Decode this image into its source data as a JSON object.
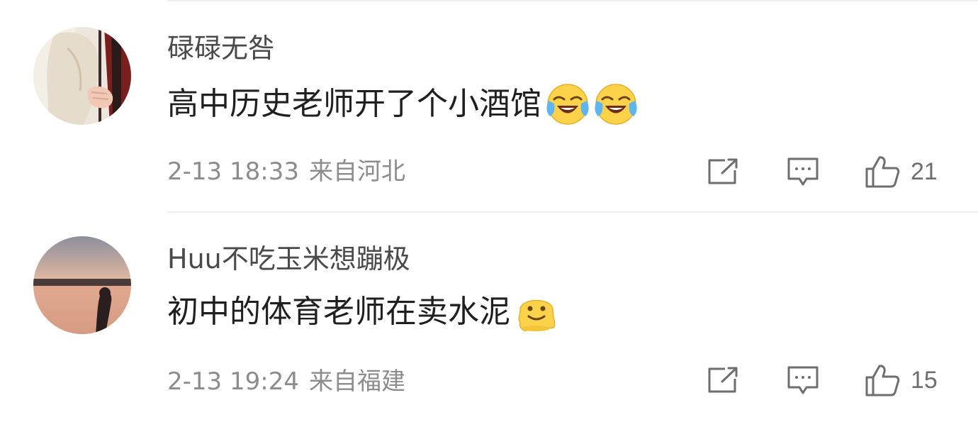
{
  "comments": [
    {
      "username": "碌碌无咎",
      "text": "高中历史老师开了个小酒馆",
      "emojis": [
        "laugh-cry-emoji",
        "laugh-cry-emoji"
      ],
      "date": "2-13 18:33",
      "location": "来自河北",
      "likes": "21"
    },
    {
      "username": "Huu不吃玉米想蹦极",
      "text": "初中的体育老师在卖水泥",
      "emojis": [
        "melting-face-emoji"
      ],
      "date": "2-13 19:24",
      "location": "来自福建",
      "likes": "15"
    }
  ],
  "icons": [
    "repost-icon",
    "comment-icon",
    "like-icon"
  ],
  "colors": {
    "username": "#4a4a4a",
    "text": "#1f1f1f",
    "meta": "#8c8c8c",
    "icon": "#6e6e6e",
    "divider": "#eeeef0"
  }
}
